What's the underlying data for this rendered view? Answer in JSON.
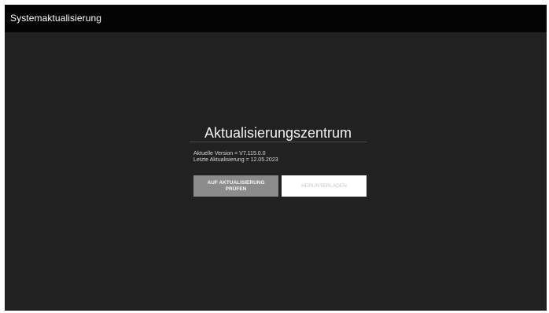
{
  "titlebar": {
    "title": "Systemaktualisierung"
  },
  "main": {
    "heading": "Aktualisierungszentrum",
    "version_line": "Aktuelle Version = V7.115.0.0",
    "last_update_line": "Letzte Aktualisierung = 12.05.2023",
    "buttons": {
      "check_label": "AUF AKTUALISIERUNG PRÜFEN",
      "download_label": "HERUNTERLADEN"
    }
  },
  "colors": {
    "background": "#212121",
    "titlebar": "#040404",
    "check_button": "#8c8c8c",
    "download_button": "#ffffff"
  }
}
